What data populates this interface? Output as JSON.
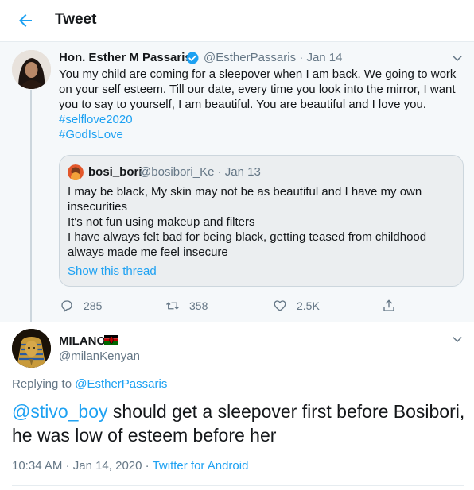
{
  "header": {
    "title": "Tweet",
    "back_icon": "arrow-left-icon"
  },
  "parent_tweet": {
    "author_name": "Hon. Esther M Passaris",
    "handle": "@EstherPassaris",
    "separator": "·",
    "date": "Jan 14",
    "text": "You my child are coming for a sleepover when I am back. We going to work on your self esteem. Till our date, every time you look into the mirror, I  want you to say to yourself, I am beautiful. You are beautiful and I love you.",
    "hashtags": [
      "#selflove2020",
      "#GodIsLove"
    ],
    "quote": {
      "author_name": "bosi_bori",
      "handle": "@bosibori_Ke",
      "separator": "·",
      "date": "Jan 13",
      "lines": [
        "I may be black, My skin may not be as beautiful and I have my own insecurities",
        "It's not fun using makeup and filters",
        "I have always felt bad for being black, getting teased from childhood always made me feel insecure"
      ],
      "show_thread": "Show this thread"
    },
    "actions": {
      "replies": "285",
      "retweets": "358",
      "likes": "2.5K"
    }
  },
  "reply_tweet": {
    "author_name": "MILANO",
    "handle": "@milanKenyan",
    "replying_prefix": "Replying to",
    "replying_to": "@EstherPassaris",
    "mention": "@stivo_boy",
    "text": " should get a sleepover first before Bosibori, he was low of esteem before her",
    "time": "10:34 AM",
    "separator": "·",
    "date": "Jan 14, 2020",
    "source": "Twitter for Android"
  },
  "colors": {
    "accent": "#1da1f2",
    "muted": "#657786",
    "thread_bg": "#f5f8fa"
  }
}
